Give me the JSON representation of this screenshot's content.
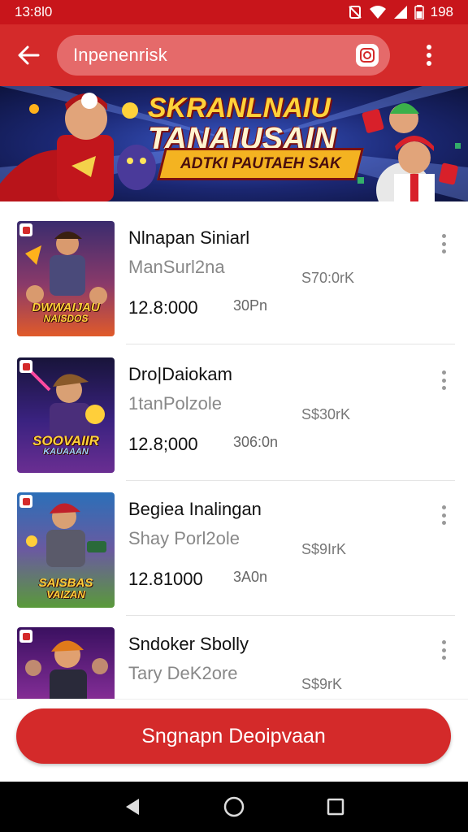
{
  "status_bar": {
    "time": "13:8l0",
    "battery_text": "198"
  },
  "app_bar": {
    "search_value": "Inpenenrisk"
  },
  "banner": {
    "title_line1": "SKRANLNAIU",
    "title_line2": "TANAIUSAIN",
    "ribbon": "ADTKI PAUTAEH SAK"
  },
  "list": {
    "items": [
      {
        "title": "Nlnapan Siniarl",
        "subtitle": "ManSurl2na",
        "price": "12.8:000",
        "meta1": "S70:0rK",
        "meta2": "30Pn",
        "thumb_logo_l1": "DWWAIJAU",
        "thumb_logo_l2": "NAISDOS",
        "thumb_color_top": "#3a2c6e",
        "thumb_color_bottom": "#e05a2a"
      },
      {
        "title": "Dro|Daiokam",
        "subtitle": "1tanPolzole",
        "price": "12.8;000",
        "meta1": "S$30rK",
        "meta2": "306:0n",
        "thumb_logo_l1": "SOOVAIIR",
        "thumb_logo_l2": "KAUAAAN",
        "thumb_color_top": "#18143a",
        "thumb_color_bottom": "#6a2e92"
      },
      {
        "title": "Begiea Inalingan",
        "subtitle": "Shay Porl2ole",
        "price": "12.81000",
        "meta1": "S$9IrK",
        "meta2": "3A0n",
        "thumb_logo_l1": "SAISBAS",
        "thumb_logo_l2": "VAIZAN",
        "thumb_color_top": "#2b6fb8",
        "thumb_color_bottom": "#5a9a3a"
      },
      {
        "title": "Sndoker Sbolly",
        "subtitle": "Tary DeK2ore",
        "price": "",
        "meta1": "S$9rK",
        "meta2": "",
        "thumb_logo_l1": "",
        "thumb_logo_l2": "",
        "thumb_color_top": "#3a1060",
        "thumb_color_bottom": "#c03aa0"
      }
    ]
  },
  "cta": {
    "label": "Sngnapn Deoipvaan"
  },
  "colors": {
    "primary": "#d42a2a",
    "status_bar": "#c8151b"
  }
}
